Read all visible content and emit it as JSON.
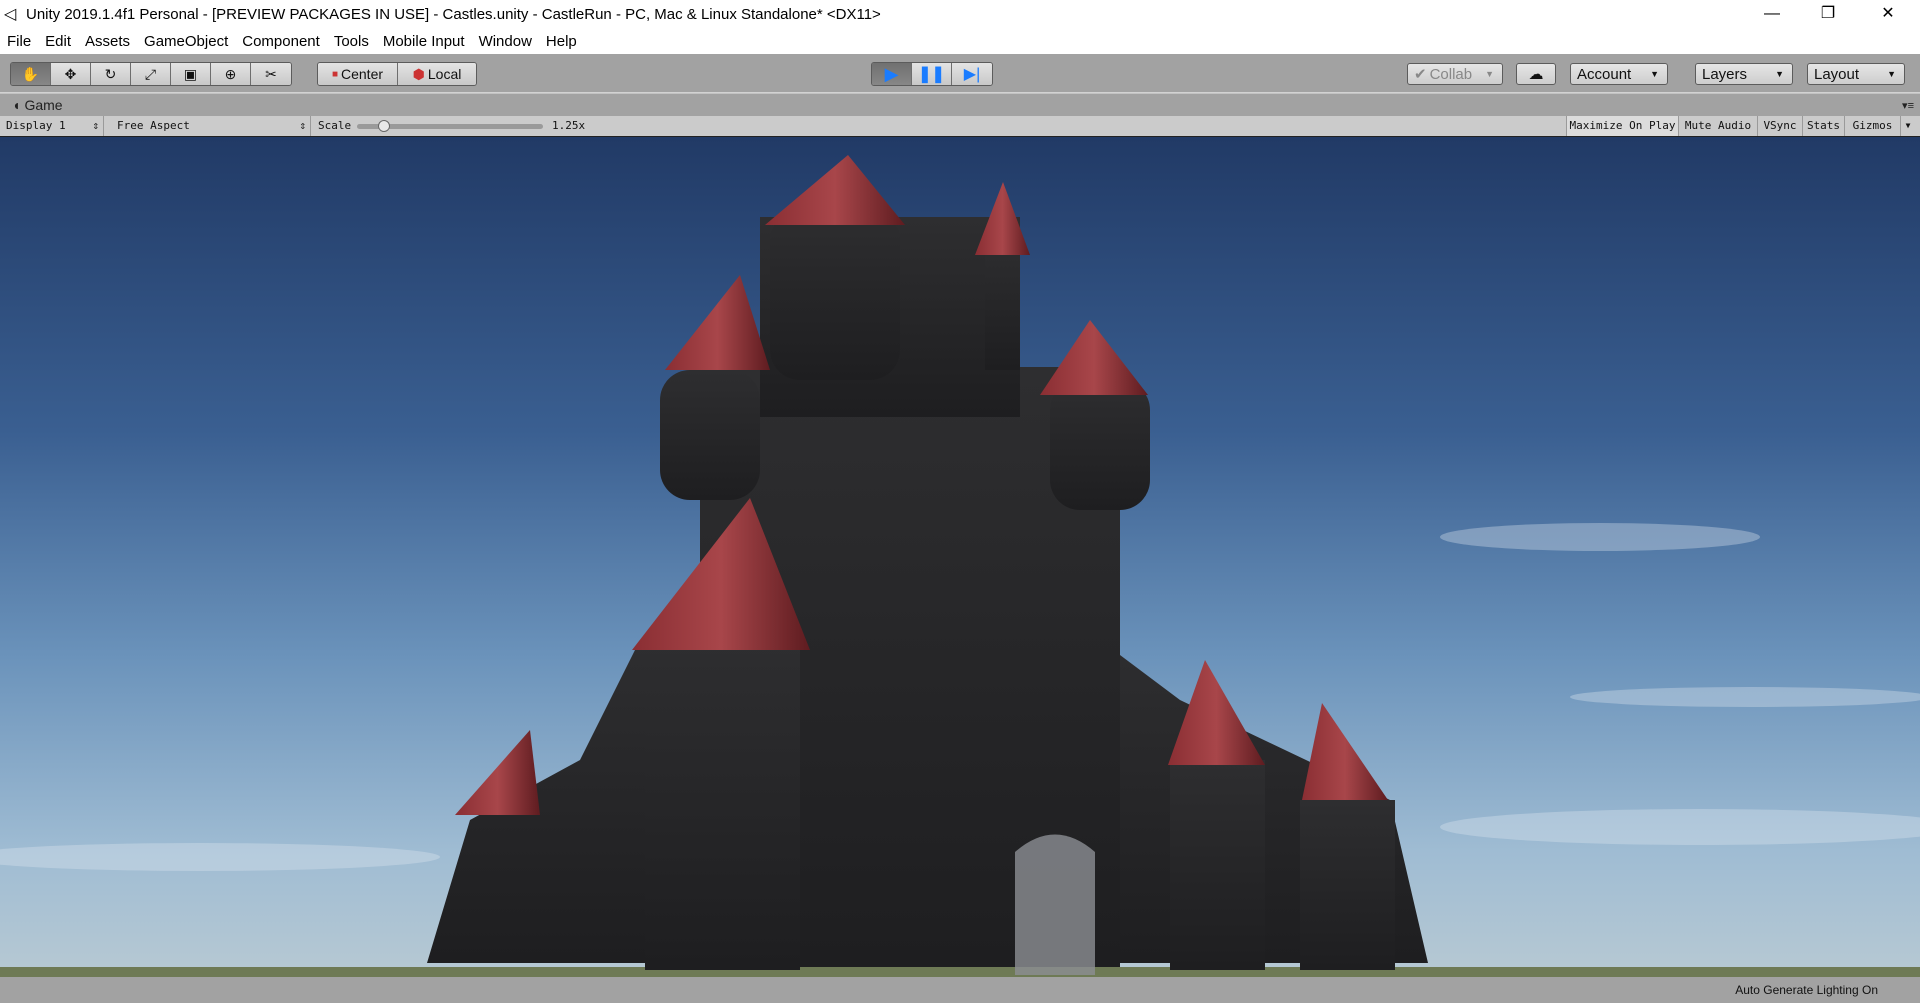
{
  "window": {
    "title": "Unity 2019.1.4f1 Personal - [PREVIEW PACKAGES IN USE] - Castles.unity - CastleRun - PC, Mac & Linux Standalone* <DX11>"
  },
  "menu": [
    "File",
    "Edit",
    "Assets",
    "GameObject",
    "Component",
    "Tools",
    "Mobile Input",
    "Window",
    "Help"
  ],
  "toolbar": {
    "pivot": "Center",
    "space": "Local",
    "collab": "Collab",
    "account": "Account",
    "layers": "Layers",
    "layout": "Layout",
    "accent": "#1a7cff"
  },
  "game_tab": {
    "label": "Game"
  },
  "game_bar": {
    "display": "Display 1",
    "aspect": "Free Aspect",
    "scale_label": "Scale",
    "scale_value": "1.25x",
    "scale_fraction": 0.12,
    "maximize": "Maximize On Play",
    "mute": "Mute Audio",
    "vsync": "VSync",
    "stats": "Stats",
    "gizmos": "Gizmos"
  },
  "status": {
    "text": "Auto Generate Lighting On"
  }
}
